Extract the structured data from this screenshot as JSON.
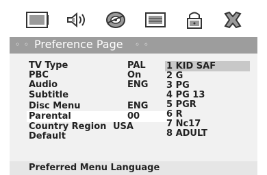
{
  "icons": [
    {
      "name": "tv-icon"
    },
    {
      "name": "audio-speaker-icon"
    },
    {
      "name": "disc-icon"
    },
    {
      "name": "video-screen-icon"
    },
    {
      "name": "lock-icon"
    },
    {
      "name": "exit-icon"
    }
  ],
  "header": {
    "dots_left": "◦ ◦",
    "title": "Preference Page",
    "dots_right": "◦ ◦"
  },
  "menu": {
    "items": [
      {
        "label": "TV Type",
        "value": "PAL"
      },
      {
        "label": "PBC",
        "value": "On"
      },
      {
        "label": "Audio",
        "value": "ENG"
      },
      {
        "label": "Subtitle",
        "value": ""
      },
      {
        "label": "Disc Menu",
        "value": "ENG"
      },
      {
        "label": "Parental",
        "value": "00"
      },
      {
        "label": "Country Region",
        "value": "USA"
      },
      {
        "label": "Default",
        "value": ""
      }
    ],
    "selected": "Parental"
  },
  "options": {
    "items": [
      "1 KID SAF",
      "2 G",
      "3 PG",
      "4 PG 13",
      "5 PGR",
      "6 R",
      "7 Nc17",
      "8 ADULT"
    ],
    "highlighted": "1 KID SAF"
  },
  "footer": {
    "text": "Preferred Menu Language"
  },
  "colors": {
    "header_bg": "#9d9d9d",
    "highlight_bg": "#c8c8c8",
    "text": "#222222"
  }
}
